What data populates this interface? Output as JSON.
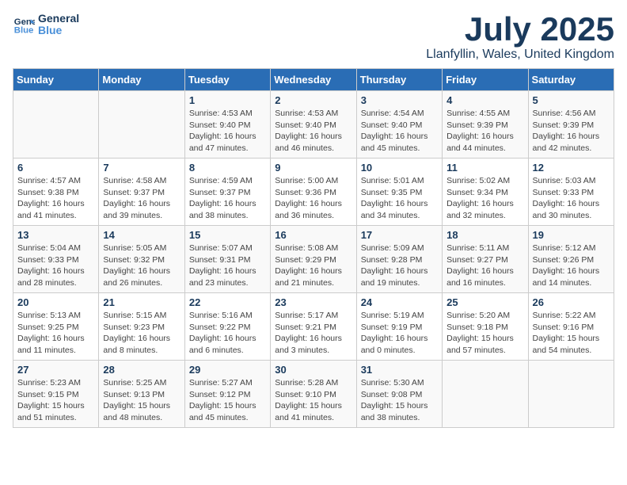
{
  "header": {
    "logo_line1": "General",
    "logo_line2": "Blue",
    "month": "July 2025",
    "location": "Llanfyllin, Wales, United Kingdom"
  },
  "weekdays": [
    "Sunday",
    "Monday",
    "Tuesday",
    "Wednesday",
    "Thursday",
    "Friday",
    "Saturday"
  ],
  "weeks": [
    [
      {
        "day": "",
        "detail": ""
      },
      {
        "day": "",
        "detail": ""
      },
      {
        "day": "1",
        "detail": "Sunrise: 4:53 AM\nSunset: 9:40 PM\nDaylight: 16 hours and 47 minutes."
      },
      {
        "day": "2",
        "detail": "Sunrise: 4:53 AM\nSunset: 9:40 PM\nDaylight: 16 hours and 46 minutes."
      },
      {
        "day": "3",
        "detail": "Sunrise: 4:54 AM\nSunset: 9:40 PM\nDaylight: 16 hours and 45 minutes."
      },
      {
        "day": "4",
        "detail": "Sunrise: 4:55 AM\nSunset: 9:39 PM\nDaylight: 16 hours and 44 minutes."
      },
      {
        "day": "5",
        "detail": "Sunrise: 4:56 AM\nSunset: 9:39 PM\nDaylight: 16 hours and 42 minutes."
      }
    ],
    [
      {
        "day": "6",
        "detail": "Sunrise: 4:57 AM\nSunset: 9:38 PM\nDaylight: 16 hours and 41 minutes."
      },
      {
        "day": "7",
        "detail": "Sunrise: 4:58 AM\nSunset: 9:37 PM\nDaylight: 16 hours and 39 minutes."
      },
      {
        "day": "8",
        "detail": "Sunrise: 4:59 AM\nSunset: 9:37 PM\nDaylight: 16 hours and 38 minutes."
      },
      {
        "day": "9",
        "detail": "Sunrise: 5:00 AM\nSunset: 9:36 PM\nDaylight: 16 hours and 36 minutes."
      },
      {
        "day": "10",
        "detail": "Sunrise: 5:01 AM\nSunset: 9:35 PM\nDaylight: 16 hours and 34 minutes."
      },
      {
        "day": "11",
        "detail": "Sunrise: 5:02 AM\nSunset: 9:34 PM\nDaylight: 16 hours and 32 minutes."
      },
      {
        "day": "12",
        "detail": "Sunrise: 5:03 AM\nSunset: 9:33 PM\nDaylight: 16 hours and 30 minutes."
      }
    ],
    [
      {
        "day": "13",
        "detail": "Sunrise: 5:04 AM\nSunset: 9:33 PM\nDaylight: 16 hours and 28 minutes."
      },
      {
        "day": "14",
        "detail": "Sunrise: 5:05 AM\nSunset: 9:32 PM\nDaylight: 16 hours and 26 minutes."
      },
      {
        "day": "15",
        "detail": "Sunrise: 5:07 AM\nSunset: 9:31 PM\nDaylight: 16 hours and 23 minutes."
      },
      {
        "day": "16",
        "detail": "Sunrise: 5:08 AM\nSunset: 9:29 PM\nDaylight: 16 hours and 21 minutes."
      },
      {
        "day": "17",
        "detail": "Sunrise: 5:09 AM\nSunset: 9:28 PM\nDaylight: 16 hours and 19 minutes."
      },
      {
        "day": "18",
        "detail": "Sunrise: 5:11 AM\nSunset: 9:27 PM\nDaylight: 16 hours and 16 minutes."
      },
      {
        "day": "19",
        "detail": "Sunrise: 5:12 AM\nSunset: 9:26 PM\nDaylight: 16 hours and 14 minutes."
      }
    ],
    [
      {
        "day": "20",
        "detail": "Sunrise: 5:13 AM\nSunset: 9:25 PM\nDaylight: 16 hours and 11 minutes."
      },
      {
        "day": "21",
        "detail": "Sunrise: 5:15 AM\nSunset: 9:23 PM\nDaylight: 16 hours and 8 minutes."
      },
      {
        "day": "22",
        "detail": "Sunrise: 5:16 AM\nSunset: 9:22 PM\nDaylight: 16 hours and 6 minutes."
      },
      {
        "day": "23",
        "detail": "Sunrise: 5:17 AM\nSunset: 9:21 PM\nDaylight: 16 hours and 3 minutes."
      },
      {
        "day": "24",
        "detail": "Sunrise: 5:19 AM\nSunset: 9:19 PM\nDaylight: 16 hours and 0 minutes."
      },
      {
        "day": "25",
        "detail": "Sunrise: 5:20 AM\nSunset: 9:18 PM\nDaylight: 15 hours and 57 minutes."
      },
      {
        "day": "26",
        "detail": "Sunrise: 5:22 AM\nSunset: 9:16 PM\nDaylight: 15 hours and 54 minutes."
      }
    ],
    [
      {
        "day": "27",
        "detail": "Sunrise: 5:23 AM\nSunset: 9:15 PM\nDaylight: 15 hours and 51 minutes."
      },
      {
        "day": "28",
        "detail": "Sunrise: 5:25 AM\nSunset: 9:13 PM\nDaylight: 15 hours and 48 minutes."
      },
      {
        "day": "29",
        "detail": "Sunrise: 5:27 AM\nSunset: 9:12 PM\nDaylight: 15 hours and 45 minutes."
      },
      {
        "day": "30",
        "detail": "Sunrise: 5:28 AM\nSunset: 9:10 PM\nDaylight: 15 hours and 41 minutes."
      },
      {
        "day": "31",
        "detail": "Sunrise: 5:30 AM\nSunset: 9:08 PM\nDaylight: 15 hours and 38 minutes."
      },
      {
        "day": "",
        "detail": ""
      },
      {
        "day": "",
        "detail": ""
      }
    ]
  ]
}
